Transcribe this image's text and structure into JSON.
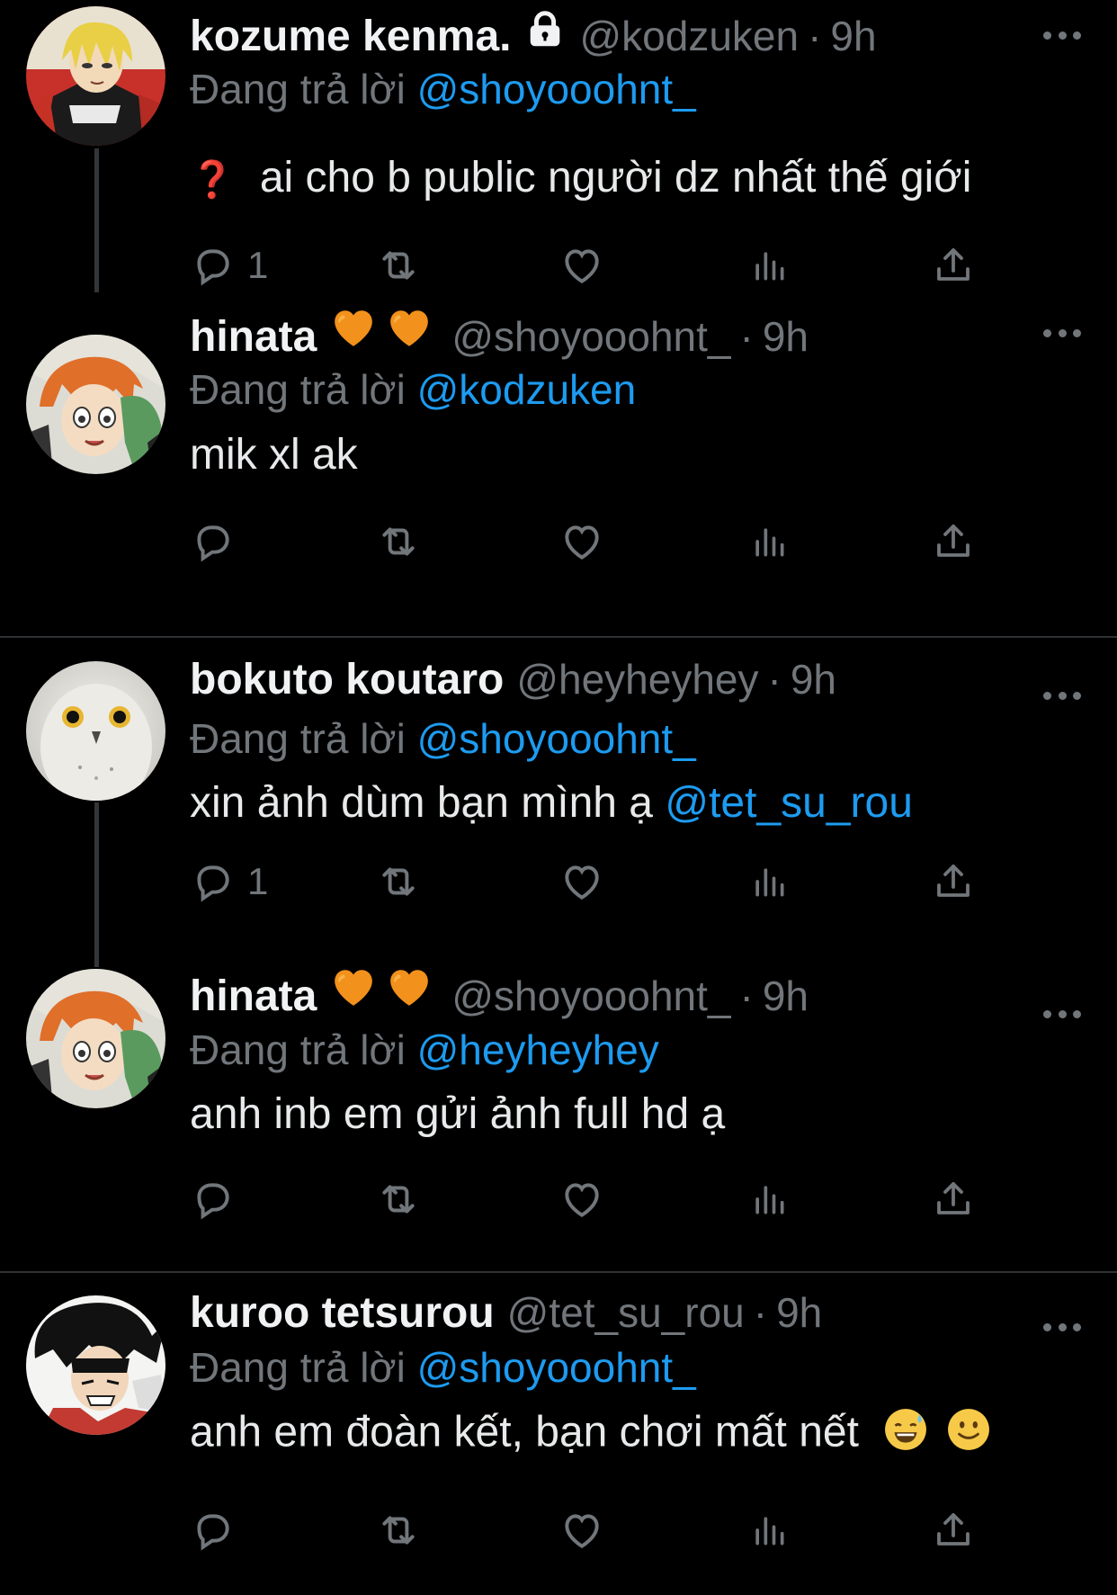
{
  "reply_prefix": "Đang trả lời",
  "tweets": [
    {
      "name": "kozume kenma.",
      "handle": "@kodzuken",
      "separator": "·",
      "time": "9h",
      "replying_to": "@shoyooohnt_",
      "text_emoji": "❓",
      "text": "ai cho b public người dz nhất thế giới",
      "reply_count": "1",
      "locked": true,
      "avatar": "kenma-avatar"
    },
    {
      "name": "hinata",
      "handle": "@shoyooohnt_",
      "separator": "·",
      "time": "9h",
      "replying_to": "@kodzuken",
      "text": "mik xl ak",
      "reply_count": "",
      "avatar": "hinata-avatar"
    },
    {
      "name": "bokuto koutaro",
      "handle": "@heyheyhey",
      "separator": "·",
      "time": "9h",
      "replying_to": "@shoyooohnt_",
      "text": "xin ảnh dùm bạn mình ạ",
      "text_mention": "@tet_su_rou",
      "reply_count": "1",
      "avatar": "owl-avatar"
    },
    {
      "name": "hinata",
      "handle": "@shoyooohnt_",
      "separator": "·",
      "time": "9h",
      "replying_to": "@heyheyhey",
      "text": "anh inb em gửi ảnh full hd ạ",
      "reply_count": "",
      "avatar": "hinata-avatar"
    },
    {
      "name": "kuroo tetsurou",
      "handle": "@tet_su_rou",
      "separator": "·",
      "time": "9h",
      "replying_to": "@shoyooohnt_",
      "text": "anh em đoàn kết, bạn chơi mất nết",
      "reply_count": "",
      "avatar": "kuroo-avatar"
    }
  ],
  "colors": {
    "background": "#000000",
    "text": "#e7e9ea",
    "muted": "#71767b",
    "link": "#1d9bf0",
    "heart_emoji": "#f2911b"
  }
}
